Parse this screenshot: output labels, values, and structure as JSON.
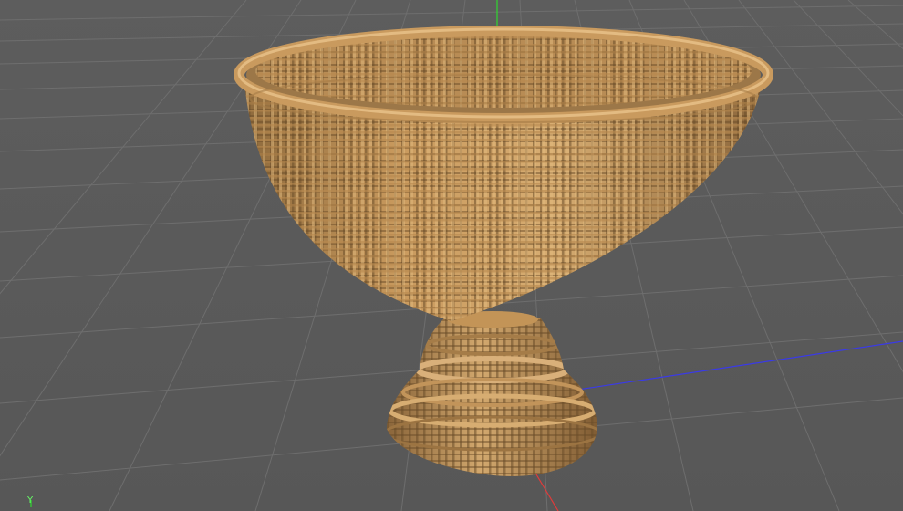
{
  "viewport": {
    "axis_gizmo_label": "Y"
  },
  "scene": {
    "object": "wicker-fruit-bowl-on-pedestal",
    "material_color": "#c99a5e",
    "material_shadow": "#7a5a32",
    "background_color": "#5a5a5a",
    "grid_color": "#6e6e6e"
  },
  "axes": {
    "x_color": "#e23a3a",
    "y_color": "#2fd82f",
    "z_color": "#3a3ae8"
  }
}
